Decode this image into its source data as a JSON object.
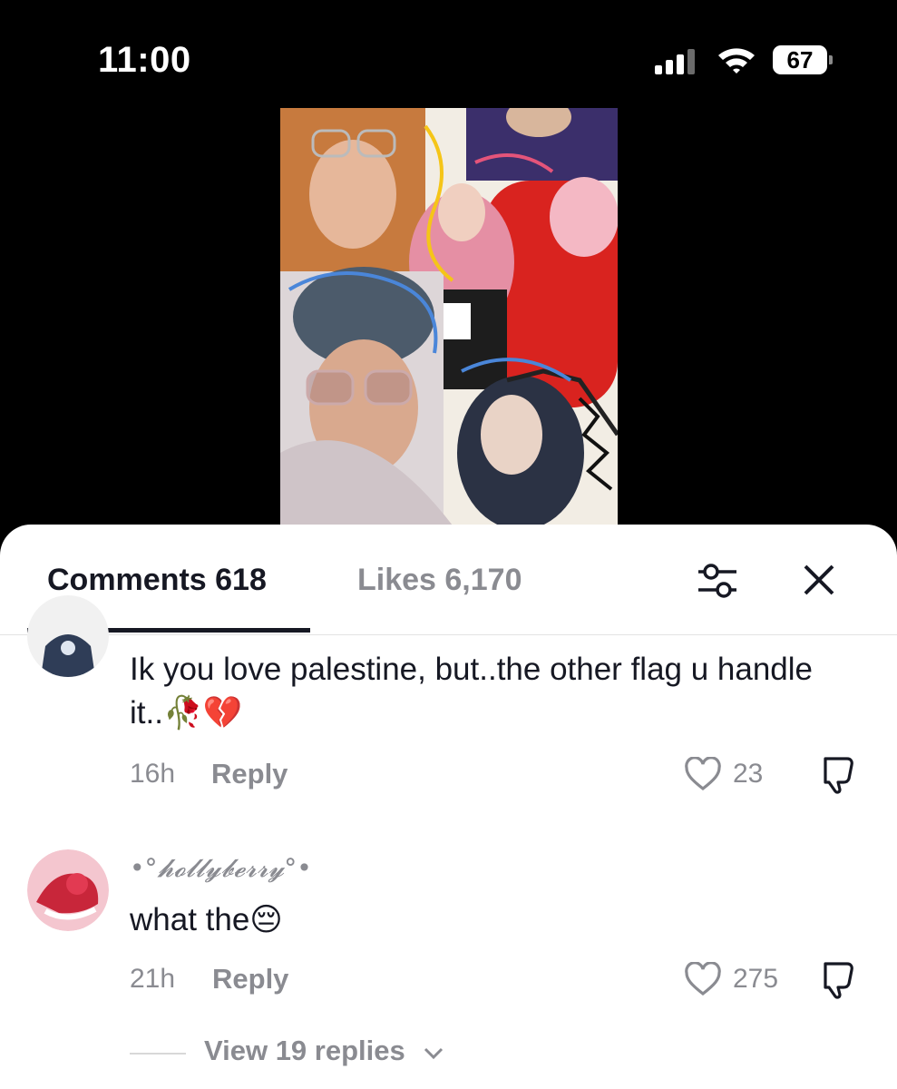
{
  "status_bar": {
    "time": "11:00",
    "battery": "67"
  },
  "tabs": {
    "comments": "Comments 618",
    "likes": "Likes 6,170"
  },
  "comments": [
    {
      "username": "",
      "text": "Ik you love palestine, but..the other flag u handle it..🥀💔",
      "time": "16h",
      "reply": "Reply",
      "likes": "23"
    },
    {
      "username": "•°𝓱𝓸𝓵𝓵𝔂𝓫𝓮𝓻𝓻𝔂°•",
      "text": "what the😔",
      "time": "21h",
      "reply": "Reply",
      "likes": "275"
    }
  ],
  "view_replies": "View 19 replies",
  "icons": [
    "signal-icon",
    "wifi-icon",
    "battery-icon",
    "filter-icon",
    "close-icon",
    "heart-icon",
    "dislike-icon",
    "chevron-down-icon"
  ],
  "colors": {
    "text_primary": "#161823",
    "text_secondary": "#8a8b91",
    "divider": "#e3e3e3"
  }
}
